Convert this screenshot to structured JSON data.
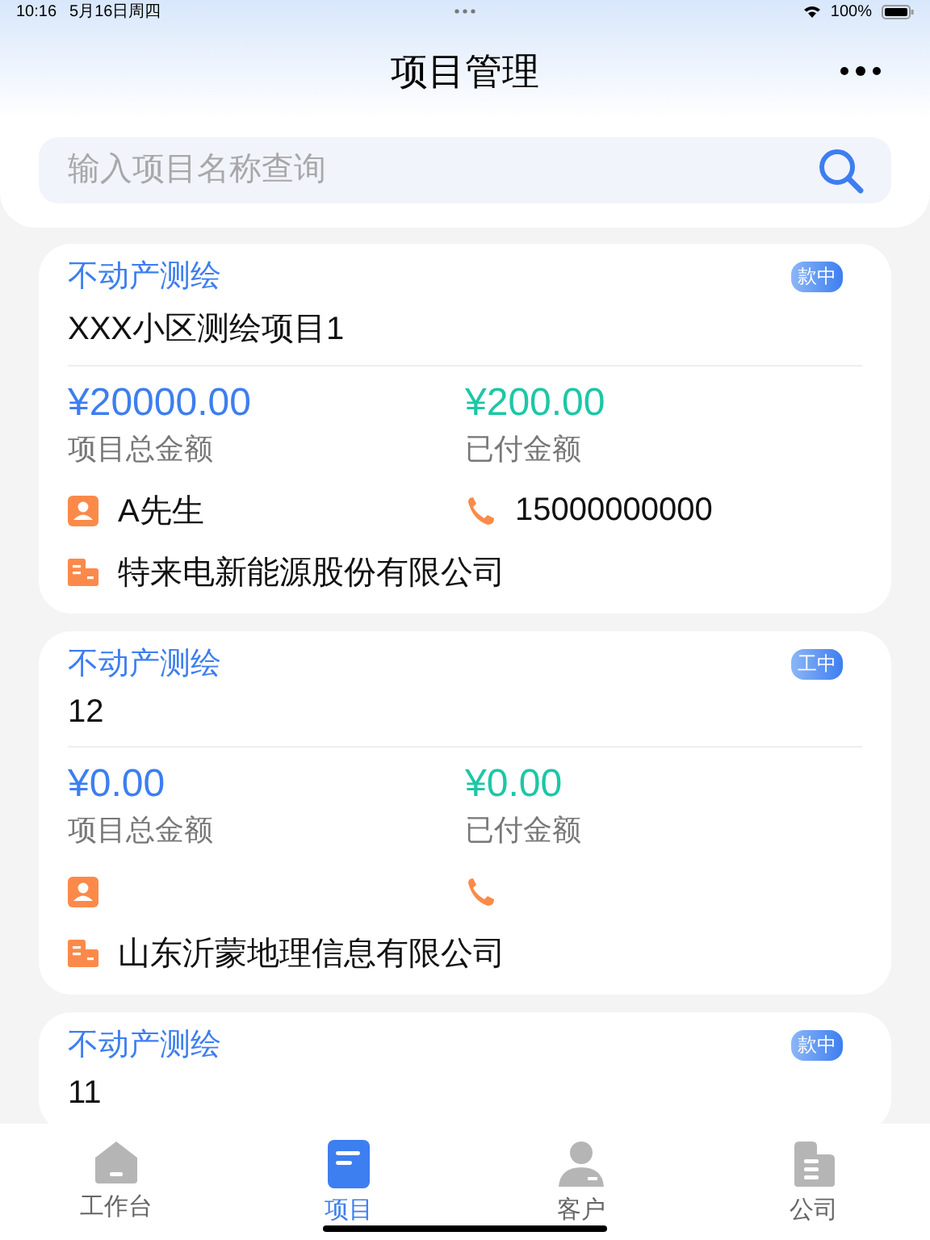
{
  "status_bar": {
    "time": "10:16",
    "date": "5月16日周四",
    "battery": "100%"
  },
  "header": {
    "title": "项目管理"
  },
  "search": {
    "placeholder": "输入项目名称查询"
  },
  "projects": [
    {
      "category": "不动产测绘",
      "name": "XXX小区测绘项目1",
      "status": "款中",
      "total": "¥20000.00",
      "total_label": "项目总金额",
      "paid": "¥200.00",
      "paid_label": "已付金额",
      "contact": "A先生",
      "phone": "15000000000",
      "company": "特来电新能源股份有限公司"
    },
    {
      "category": "不动产测绘",
      "name": "12",
      "status": "工中",
      "total": "¥0.00",
      "total_label": "项目总金额",
      "paid": "¥0.00",
      "paid_label": "已付金额",
      "company": "山东沂蒙地理信息有限公司"
    },
    {
      "category": "不动产测绘",
      "name": "11",
      "status": "款中"
    }
  ],
  "tabs": [
    {
      "label": "工作台",
      "selected": false
    },
    {
      "label": "项目",
      "selected": true
    },
    {
      "label": "客户",
      "selected": false
    },
    {
      "label": "公司",
      "selected": false
    }
  ]
}
